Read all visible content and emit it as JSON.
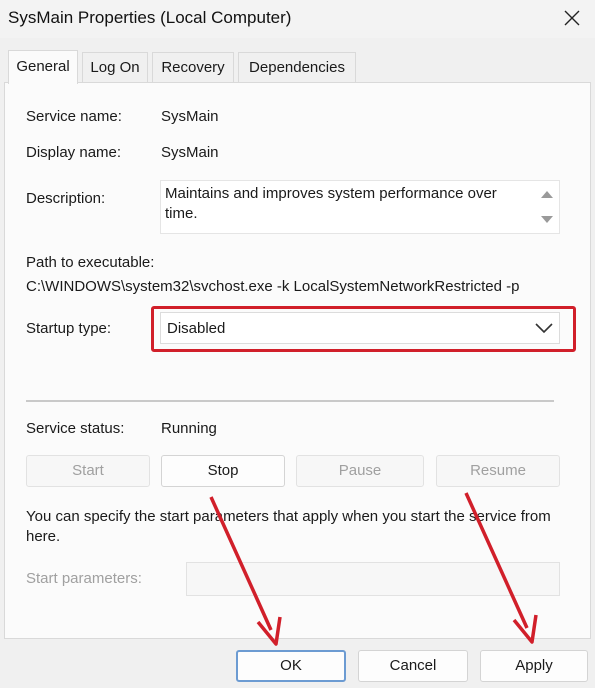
{
  "window": {
    "title": "SysMain Properties (Local Computer)"
  },
  "tabs": [
    {
      "label": "General",
      "active": true
    },
    {
      "label": "Log On",
      "active": false
    },
    {
      "label": "Recovery",
      "active": false
    },
    {
      "label": "Dependencies",
      "active": false
    }
  ],
  "general": {
    "service_name_label": "Service name:",
    "service_name_value": "SysMain",
    "display_name_label": "Display name:",
    "display_name_value": "SysMain",
    "description_label": "Description:",
    "description_value": "Maintains and improves system performance over time.",
    "path_label": "Path to executable:",
    "path_value": "C:\\WINDOWS\\system32\\svchost.exe -k LocalSystemNetworkRestricted -p",
    "startup_type_label": "Startup type:",
    "startup_type_value": "Disabled",
    "service_status_label": "Service status:",
    "service_status_value": "Running",
    "buttons": {
      "start": "Start",
      "stop": "Stop",
      "pause": "Pause",
      "resume": "Resume"
    },
    "hint_text": "You can specify the start parameters that apply when you start the service from here.",
    "start_params_label": "Start parameters:",
    "start_params_value": ""
  },
  "footer": {
    "ok_label": "OK",
    "cancel_label": "Cancel",
    "apply_label": "Apply"
  },
  "colors": {
    "annotation_red": "#d11f2a",
    "ok_border": "#6c9bd2"
  },
  "icons": {
    "close": "close-icon",
    "chevron": "chevron-down-icon",
    "scroll_up": "scroll-up-icon",
    "scroll_down": "scroll-down-icon"
  }
}
